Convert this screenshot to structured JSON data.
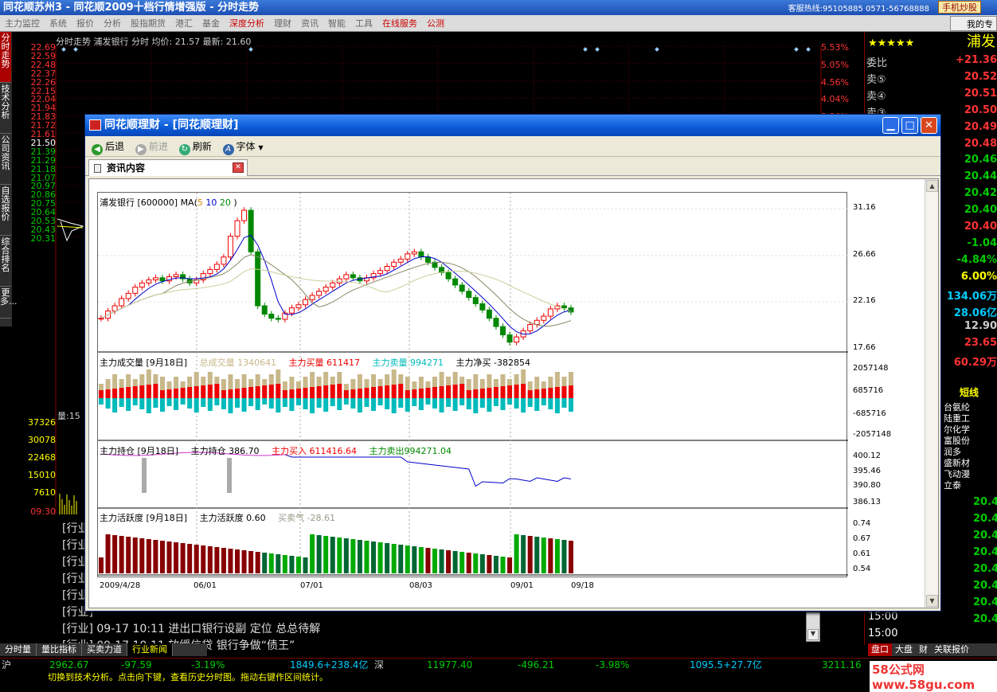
{
  "app": {
    "title": "同花顺苏州3 - 同花顺2009十档行情增强版 - 分时走势",
    "hotline": "客服热线:95105885 0571-56768888",
    "phone_btn": "手机炒股"
  },
  "menu": [
    "主力监控",
    "系统",
    "报价",
    "分析",
    "股指期货",
    "港汇",
    "基金",
    "深度分析",
    "理财",
    "资讯",
    "智能",
    "工具",
    "在线服务",
    "公测"
  ],
  "menu_red": [
    "深度分析",
    "在线服务",
    "公测"
  ],
  "my_stock": "我的专",
  "left_tabs": [
    "分时走势",
    "技术分析",
    "公司资讯",
    "自选报价",
    "综合排名",
    "更多..."
  ],
  "intraday": {
    "header": "分时走势  浦发银行 分时 均价: 21.57 最新: 21.60",
    "prices": [
      "22.69",
      "22.59",
      "22.48",
      "22.37",
      "22.26",
      "22.15",
      "22.04",
      "21.94",
      "21.83",
      "21.72",
      "21.61",
      "21.50",
      "21.39",
      "21.29",
      "21.18",
      "21.07",
      "20.97",
      "20.86",
      "20.75",
      "20.64",
      "20.53",
      "20.43",
      "20.31"
    ],
    "pcts": [
      "5.53%",
      "5.05%",
      "4.56%",
      "4.04%",
      "3.56%"
    ],
    "volumes": [
      "37326",
      "30078",
      "22468",
      "15010",
      "7610"
    ],
    "time_label": "09:30",
    "vol_label": "量:15"
  },
  "news": [
    "[行业]",
    "[行业]",
    "[行业]",
    "[行业]",
    "[行业]",
    "[行业]",
    "[行业]  09-17 10:11  进出口银行设副 定位 总总待解",
    "[行业]  09-17 10:11  放缓信贷 银行争做“债王”"
  ],
  "bottom_tabs": [
    "分时量",
    "量比指标",
    "买卖力道",
    "行业新闻"
  ],
  "right_panel": {
    "name": "浦发",
    "stars": "★★★★★",
    "rows": [
      {
        "label": "委比",
        "value": "+21.36",
        "color": "#f33"
      },
      {
        "label": "卖⑤",
        "value": "20.52",
        "color": "#f33"
      },
      {
        "label": "卖④",
        "value": "20.51",
        "color": "#f33"
      },
      {
        "label": "卖③",
        "value": "20.50",
        "color": "#f33"
      },
      {
        "label": "",
        "value": "20.49",
        "color": "#f33"
      },
      {
        "label": "",
        "value": "20.48",
        "color": "#f33"
      },
      {
        "label": "",
        "value": "20.46",
        "color": "#0c0"
      },
      {
        "label": "",
        "value": "20.44",
        "color": "#0c0"
      },
      {
        "label": "",
        "value": "20.42",
        "color": "#0c0"
      },
      {
        "label": "",
        "value": "20.40",
        "color": "#0c0"
      },
      {
        "label": "",
        "value": "20.40",
        "color": "#f33"
      },
      {
        "label": "",
        "value": "-1.04",
        "color": "#0c0"
      },
      {
        "label": "",
        "value": "-4.84%",
        "color": "#0c0"
      },
      {
        "label": "",
        "value": "6.00%",
        "color": "#ff0"
      },
      {
        "label": "",
        "value": "134.06万",
        "color": "#0cf"
      },
      {
        "label": "",
        "value": "28.06亿",
        "color": "#0cf"
      },
      {
        "label": "",
        "value": "12.90",
        "color": "#ccc"
      },
      {
        "label": "",
        "value": "23.65",
        "color": "#f33"
      },
      {
        "label": "",
        "value": "60.29万",
        "color": "#f33"
      }
    ],
    "short_label": "短线",
    "stock_list": [
      "台氨纶",
      "陆重工",
      "尔化学",
      "富股份",
      "润多",
      "盛新材",
      "飞动漫",
      "立泰"
    ],
    "lower_vals": [
      "20.4",
      "20.4",
      "20.4",
      "20.4",
      "20.4",
      "20.4",
      "20.4",
      "20.4"
    ],
    "times": [
      "15:00",
      "15:00"
    ],
    "tabs": [
      "盘口",
      "大盘",
      "财",
      "关联报价"
    ]
  },
  "index_bar": {
    "sh_label": "沪",
    "sh": "2962.67",
    "sh_chg": "-97.59",
    "sh_pct": "-3.19%",
    "sh_amt": "1849.6+238.4亿",
    "sz_label": "深",
    "sz": "11977.40",
    "sz_chg": "-496.21",
    "sz_pct": "-3.98%",
    "sz_amt": "1095.5+27.7亿",
    "other": "3211.16"
  },
  "status": "切换到技术分析。点击向下键，查看历史分时图。拖动右键作区间统计。",
  "watermark": "58公式网 www.58gu.com",
  "popup": {
    "title": "同花顺理财 - [同花顺理财]",
    "toolbar": {
      "back": "后退",
      "forward": "前进",
      "refresh": "刷新",
      "font": "字体"
    },
    "tab": "资讯内容",
    "panels": {
      "price_head": "浦发银行 [600000] MA(",
      "ma_labels": [
        "5",
        "10",
        "20"
      ],
      "ma_close": ")",
      "vol_head": "主力成交量 [9月18日]",
      "vol_items": [
        {
          "t": "总成交量 1340641",
          "c": "#c8b88a"
        },
        {
          "t": "主力买量 611417",
          "c": "#e00"
        },
        {
          "t": "主力卖量 994271",
          "c": "#0bb"
        },
        {
          "t": "主力净买 -382854",
          "c": "#000"
        }
      ],
      "hold_head": "主力持仓 [9月18日]",
      "hold_items": [
        {
          "t": "主力持仓 386.70",
          "c": "#000"
        },
        {
          "t": "主力买入 611416.64",
          "c": "#e00"
        },
        {
          "t": "主力卖出994271.04",
          "c": "#080"
        }
      ],
      "act_head": "主力活跃度 [9月18日]",
      "act_items": [
        {
          "t": "主力活跃度 0.60",
          "c": "#000"
        },
        {
          "t": "买卖气 -28.61",
          "c": "#998"
        }
      ],
      "price_axis": [
        "31.16",
        "26.66",
        "22.16",
        "17.66"
      ],
      "vol_axis": [
        "2057148",
        "685716",
        "-685716",
        "-2057148"
      ],
      "hold_axis": [
        "400.12",
        "395.46",
        "390.80",
        "386.13"
      ],
      "act_axis": [
        "0.74",
        "0.67",
        "0.61",
        "0.54"
      ],
      "dates": [
        "2009/4/28",
        "06/01",
        "07/01",
        "08/03",
        "09/01",
        "09/18"
      ]
    }
  },
  "chart_data": {
    "type": "candlestick",
    "title": "浦发银行 [600000]",
    "ylim": [
      17.66,
      31.16
    ],
    "x_ticks": [
      "2009/4/28",
      "06/01",
      "07/01",
      "08/03",
      "09/01",
      "09/18"
    ],
    "close": [
      20.6,
      21.3,
      21.8,
      22.5,
      23.0,
      23.6,
      24.0,
      24.3,
      24.5,
      24.2,
      24.6,
      24.8,
      24.4,
      24.0,
      24.3,
      24.9,
      25.3,
      25.8,
      26.5,
      28.5,
      30.0,
      31.0,
      27.0,
      21.8,
      21.0,
      20.6,
      20.5,
      21.1,
      21.6,
      21.9,
      22.4,
      22.8,
      23.2,
      23.6,
      24.0,
      24.4,
      24.8,
      24.5,
      24.2,
      24.5,
      24.9,
      25.2,
      25.6,
      26.0,
      26.3,
      26.8,
      27.0,
      26.5,
      26.0,
      25.5,
      25.0,
      24.4,
      23.8,
      23.2,
      22.6,
      22.0,
      21.4,
      20.6,
      19.8,
      19.0,
      18.3,
      18.8,
      19.4,
      20.0,
      20.4,
      20.8,
      21.5,
      21.8,
      21.6,
      21.2
    ]
  }
}
